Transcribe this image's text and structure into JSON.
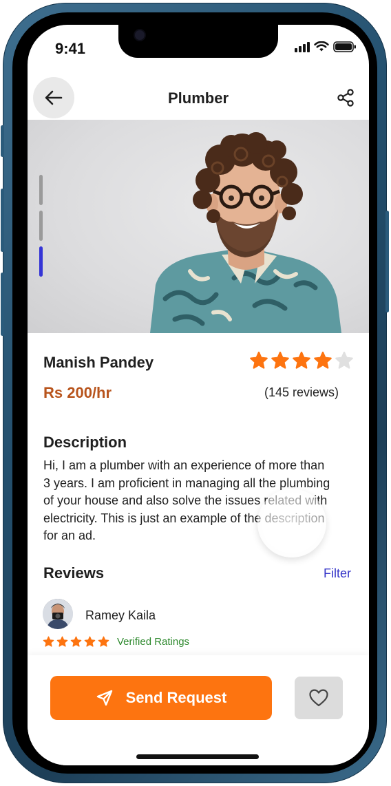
{
  "status_bar": {
    "time": "9:41"
  },
  "header": {
    "title": "Plumber"
  },
  "gallery": {
    "pages": 3,
    "active_page": 3
  },
  "profile": {
    "name": "Manish Pandey",
    "rating": 4,
    "rating_max": 5,
    "price": "Rs 200/hr",
    "reviews_count": "(145 reviews)"
  },
  "description": {
    "title": "Description",
    "text": "Hi, I am a plumber with an experience of more than\n3 years. I am proficient in managing all the plumbing\n of  your house and also solve the issues related with\nelectricity. This is just an example of the description\nfor an ad."
  },
  "reviews": {
    "title": "Reviews",
    "filter_label": "Filter",
    "items": [
      {
        "name": "Ramey Kaila",
        "rating": 5,
        "badge": "Verified Ratings"
      }
    ]
  },
  "actions": {
    "send_label": "Send Request"
  },
  "colors": {
    "accent": "#fd7410",
    "price": "#b8541c",
    "link": "#3434c8",
    "verified": "#2f8a2f",
    "pager_active": "#3535d6",
    "star_empty": "#e0e0e0"
  },
  "icons": {
    "back": "arrow-left-icon",
    "share": "share-icon",
    "send": "send-icon",
    "favorite": "heart-outline-icon"
  }
}
